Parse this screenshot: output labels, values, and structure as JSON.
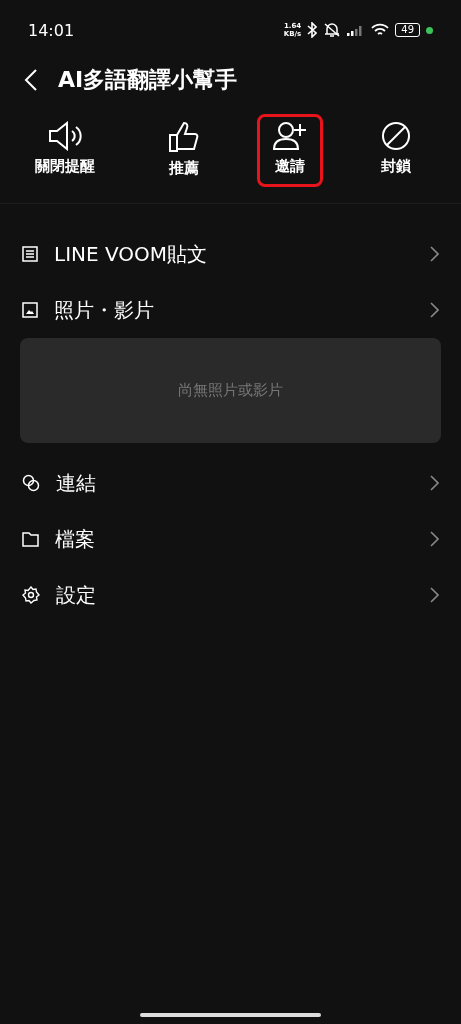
{
  "status_bar": {
    "time": "14:01",
    "speed_value": "1.64",
    "speed_unit": "KB/s",
    "battery": "49"
  },
  "header": {
    "title": "AI多語翻譯小幫手"
  },
  "actions": [
    {
      "kind": "mute",
      "label": "關閉提醒",
      "highlighted": false
    },
    {
      "kind": "recommend",
      "label": "推薦",
      "highlighted": false
    },
    {
      "kind": "invite",
      "label": "邀請",
      "highlighted": true
    },
    {
      "kind": "block",
      "label": "封鎖",
      "highlighted": false
    }
  ],
  "menu": [
    {
      "kind": "posts",
      "label": "LINE VOOM貼文"
    },
    {
      "kind": "photos",
      "label": "照片・影片",
      "empty_text": "尚無照片或影片"
    },
    {
      "kind": "links",
      "label": "連結"
    },
    {
      "kind": "files",
      "label": "檔案"
    },
    {
      "kind": "settings",
      "label": "設定"
    }
  ]
}
